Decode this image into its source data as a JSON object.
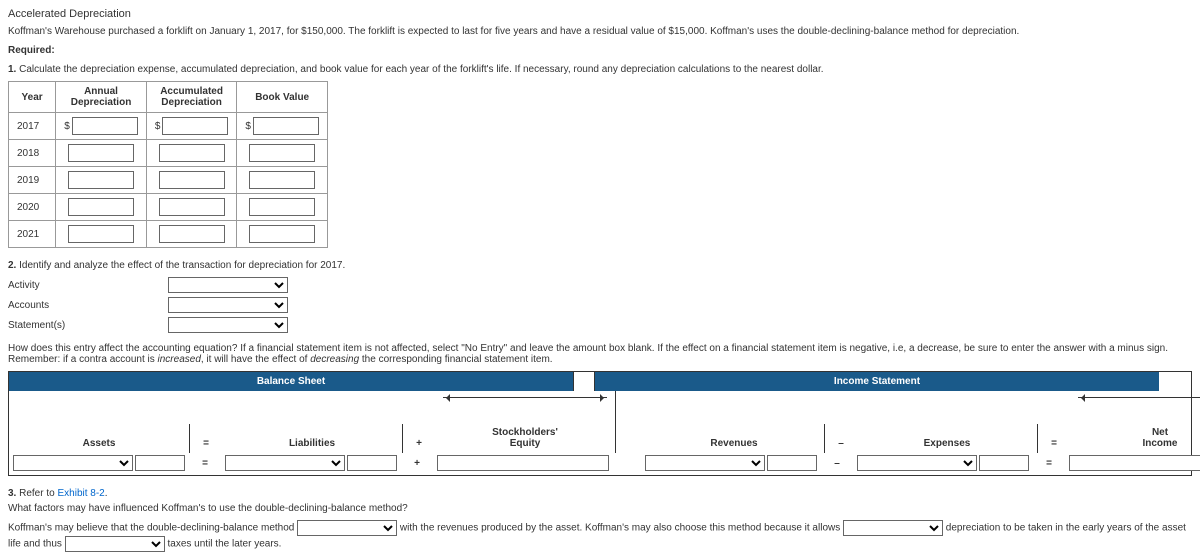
{
  "title": "Accelerated Depreciation",
  "intro": "Koffman's Warehouse purchased a forklift on January 1, 2017, for $150,000. The forklift is expected to last for five years and have a residual value of $15,000. Koffman's uses the double-declining-balance method for depreciation.",
  "required_label": "Required:",
  "q1_num": "1.",
  "q1_text": "Calculate the depreciation expense, accumulated depreciation, and book value for each year of the forklift's life. If necessary, round any depreciation calculations to the nearest dollar.",
  "dep_headers": {
    "year": "Year",
    "annual": "Annual\nDepreciation",
    "accum": "Accumulated\nDepreciation",
    "bv": "Book Value"
  },
  "years": [
    "2017",
    "2018",
    "2019",
    "2020",
    "2021"
  ],
  "q2_num": "2.",
  "q2_text": "Identify and analyze the effect of the transaction for depreciation for 2017.",
  "q2_labels": {
    "activity": "Activity",
    "accounts": "Accounts",
    "statements": "Statement(s)"
  },
  "eq_intro_a": "How does this entry affect the accounting equation? If a financial statement item is not affected, select \"No Entry\" and leave the amount box blank. If the effect on a financial statement item is negative, i.e, a decrease, be sure to enter the answer with a minus sign. Remember: if a contra account is ",
  "eq_intro_b": "increased",
  "eq_intro_c": ", it will have the effect of ",
  "eq_intro_d": "decreasing",
  "eq_intro_e": " the corresponding financial statement item.",
  "eq_headers": {
    "bs": "Balance Sheet",
    "is": "Income Statement"
  },
  "eq_cols": {
    "assets": "Assets",
    "liab": "Liabilities",
    "se": "Stockholders'\nEquity",
    "rev": "Revenues",
    "exp": "Expenses",
    "net": "Net\nIncome"
  },
  "signs": {
    "eq": "=",
    "plus": "+",
    "minus": "–"
  },
  "q3_num": "3.",
  "q3_a": "Refer to ",
  "q3_link": "Exhibit 8-2",
  "q3_b": ".",
  "q3_prompt": "What factors may have influenced Koffman's to use the double-declining-balance method?",
  "q3_sent_a": "Koffman's may believe that the double-declining-balance method ",
  "q3_sent_b": " with the revenues produced by the asset. Koffman's may also choose this method because it allows ",
  "q3_sent_c": " depreciation to be taken in the early years of the asset life and thus ",
  "q3_sent_d": " taxes until the later years."
}
